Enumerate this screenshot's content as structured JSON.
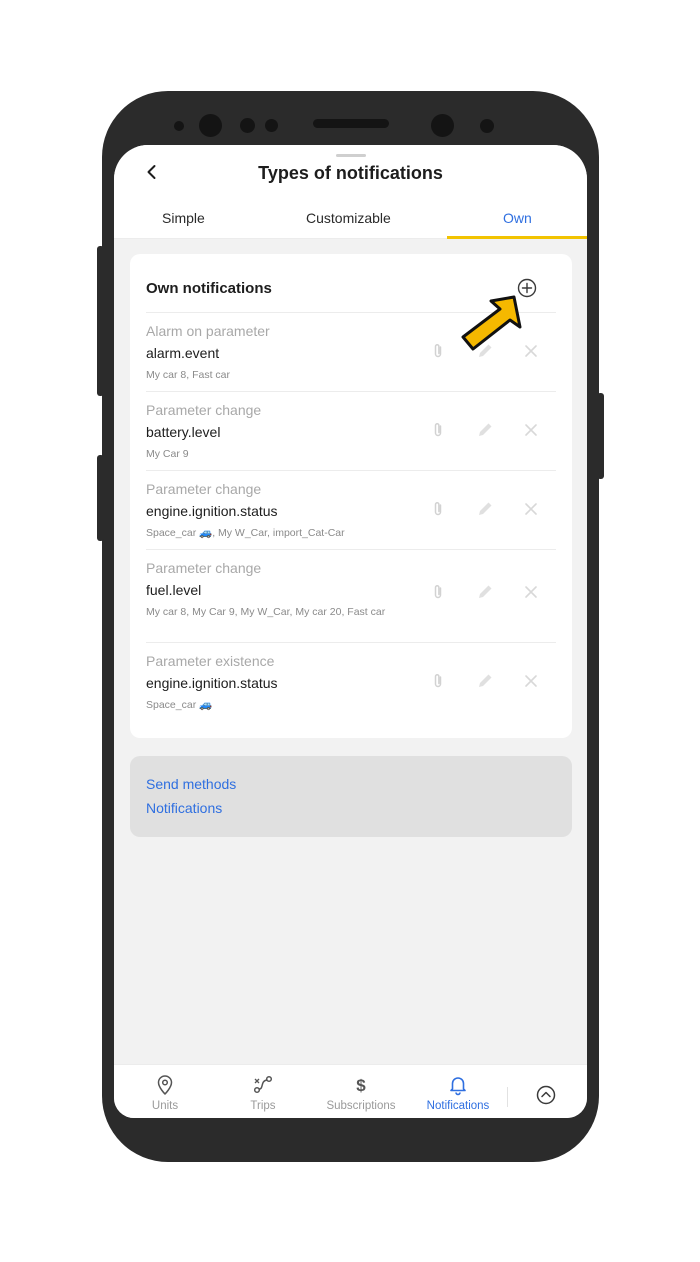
{
  "header": {
    "title": "Types of notifications"
  },
  "tabs": [
    {
      "label": "Simple"
    },
    {
      "label": "Customizable"
    },
    {
      "label": "Own"
    }
  ],
  "own": {
    "title": "Own notifications",
    "rows": [
      {
        "type": "Alarm on parameter",
        "param": "alarm.event",
        "units": "My car 8, Fast car"
      },
      {
        "type": "Parameter change",
        "param": "battery.level",
        "units": "My Car 9"
      },
      {
        "type": "Parameter change",
        "param": "engine.ignition.status",
        "units": "Space_car 🚙, My W_Car, import_Cat-Car"
      },
      {
        "type": "Parameter change",
        "param": "fuel.level",
        "units": "My car 8, My Car 9, My W_Car, My car 20, Fast car"
      },
      {
        "type": "Parameter existence",
        "param": "engine.ignition.status",
        "units": "Space_car 🚙"
      }
    ]
  },
  "links": {
    "send_methods": "Send methods",
    "notifications": "Notifications"
  },
  "nav": {
    "items": [
      {
        "label": "Units",
        "icon": "map-pin-icon"
      },
      {
        "label": "Trips",
        "icon": "route-icon"
      },
      {
        "label": "Subscriptions",
        "icon": "dollar-icon"
      },
      {
        "label": "Notifications",
        "icon": "bell-icon"
      }
    ],
    "active": "Notifications"
  },
  "colors": {
    "accent": "#2f6fe0",
    "tab_indicator": "#f2c300",
    "pointer_arrow": "#f5b800"
  }
}
